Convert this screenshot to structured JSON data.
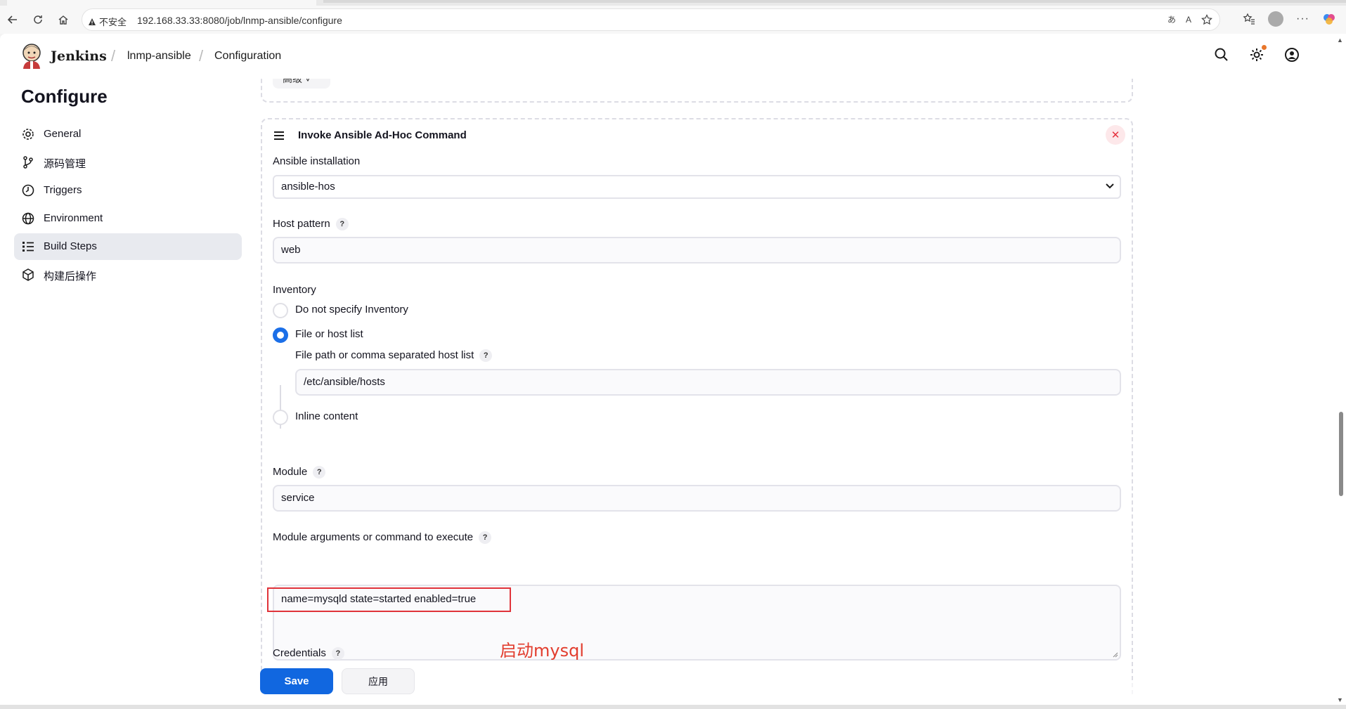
{
  "browser": {
    "security_label": "不安全",
    "url": "192.168.33.33:8080/job/lnmp-ansible/configure"
  },
  "header": {
    "brand": "Jenkins",
    "breadcrumbs": [
      "lnmp-ansible",
      "Configuration"
    ]
  },
  "sidebar": {
    "title": "Configure",
    "items": [
      {
        "label": "General",
        "icon": "gear-icon"
      },
      {
        "label": "源码管理",
        "icon": "branch-icon"
      },
      {
        "label": "Triggers",
        "icon": "clock-icon"
      },
      {
        "label": "Environment",
        "icon": "globe-icon"
      },
      {
        "label": "Build Steps",
        "icon": "list-icon",
        "active": true
      },
      {
        "label": "构建后操作",
        "icon": "cube-icon"
      }
    ]
  },
  "main": {
    "advanced_button": "高级",
    "card_title": "Invoke Ansible Ad-Hoc Command",
    "ansible_installation": {
      "label": "Ansible installation",
      "value": "ansible-hos"
    },
    "host_pattern": {
      "label": "Host pattern",
      "value": "web"
    },
    "inventory": {
      "label": "Inventory",
      "options": [
        "Do not specify Inventory",
        "File or host list",
        "Inline content"
      ],
      "selected": "File or host list",
      "file_path_label": "File path or comma separated host list",
      "file_path_value": "/etc/ansible/hosts"
    },
    "module": {
      "label": "Module",
      "value": "service"
    },
    "module_args": {
      "label": "Module arguments or command to execute",
      "value": "name=mysqld state=started enabled=true"
    },
    "annotation": "启动mysql",
    "credentials_label": "Credentials",
    "help_glyph": "?",
    "close_glyph": "✕"
  },
  "actions": {
    "save": "Save",
    "apply": "应用"
  }
}
